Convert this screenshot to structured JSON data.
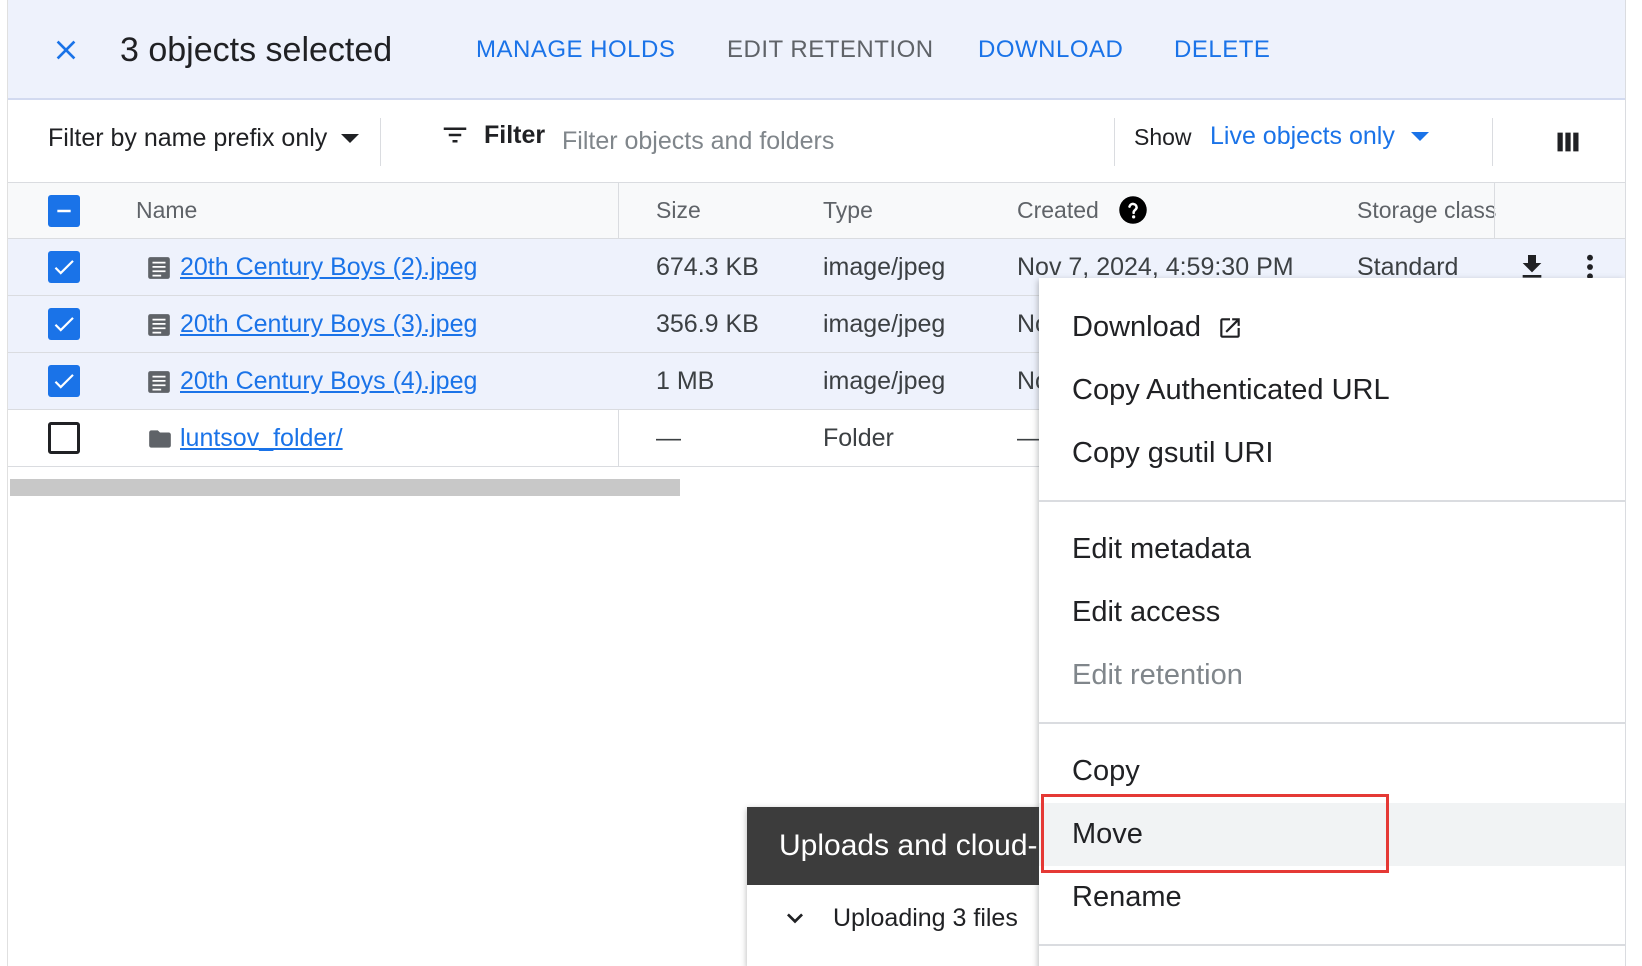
{
  "selection": {
    "title": "3 objects selected",
    "actions": {
      "manage_holds": "MANAGE HOLDS",
      "edit_retention": "EDIT RETENTION",
      "download": "DOWNLOAD",
      "delete": "DELETE"
    }
  },
  "filter_bar": {
    "prefix_mode": "Filter by name prefix only",
    "filter_label": "Filter",
    "search_placeholder": "Filter objects and folders",
    "show_label": "Show",
    "show_value": "Live objects only"
  },
  "table": {
    "columns": {
      "name": "Name",
      "size": "Size",
      "type": "Type",
      "created": "Created",
      "storage_class": "Storage class"
    },
    "rows": [
      {
        "name": "20th Century Boys (2).jpeg",
        "size": "674.3 KB",
        "type": "image/jpeg",
        "created": "Nov 7, 2024, 4:59:30 PM",
        "storage_class": "Standard",
        "checked": true
      },
      {
        "name": "20th Century Boys (3).jpeg",
        "size": "356.9 KB",
        "type": "image/jpeg",
        "created": "No",
        "checked": true
      },
      {
        "name": "20th Century Boys (4).jpeg",
        "size": "1 MB",
        "type": "image/jpeg",
        "created": "No",
        "checked": true
      },
      {
        "name": "luntsov_folder/",
        "size": "—",
        "type": "Folder",
        "created": "—",
        "checked": false
      }
    ]
  },
  "context_menu": {
    "download": "Download",
    "copy_auth_url": "Copy Authenticated URL",
    "copy_gsutil": "Copy gsutil URI",
    "edit_metadata": "Edit metadata",
    "edit_access": "Edit access",
    "edit_retention": "Edit retention",
    "copy": "Copy",
    "move": "Move",
    "rename": "Rename"
  },
  "uploads": {
    "title": "Uploads and cloud-p",
    "status": "Uploading 3 files"
  },
  "colors": {
    "accent": "#1a73e8",
    "selection_bg": "#eef2fc",
    "highlight": "#e53935"
  },
  "icons": [
    "close-icon",
    "filter-icon",
    "columns-icon",
    "help-icon",
    "file-icon",
    "folder-icon",
    "download-icon",
    "more-vert-icon",
    "open-external-icon",
    "chevron-down-icon",
    "check-icon",
    "indeterminate-icon"
  ]
}
